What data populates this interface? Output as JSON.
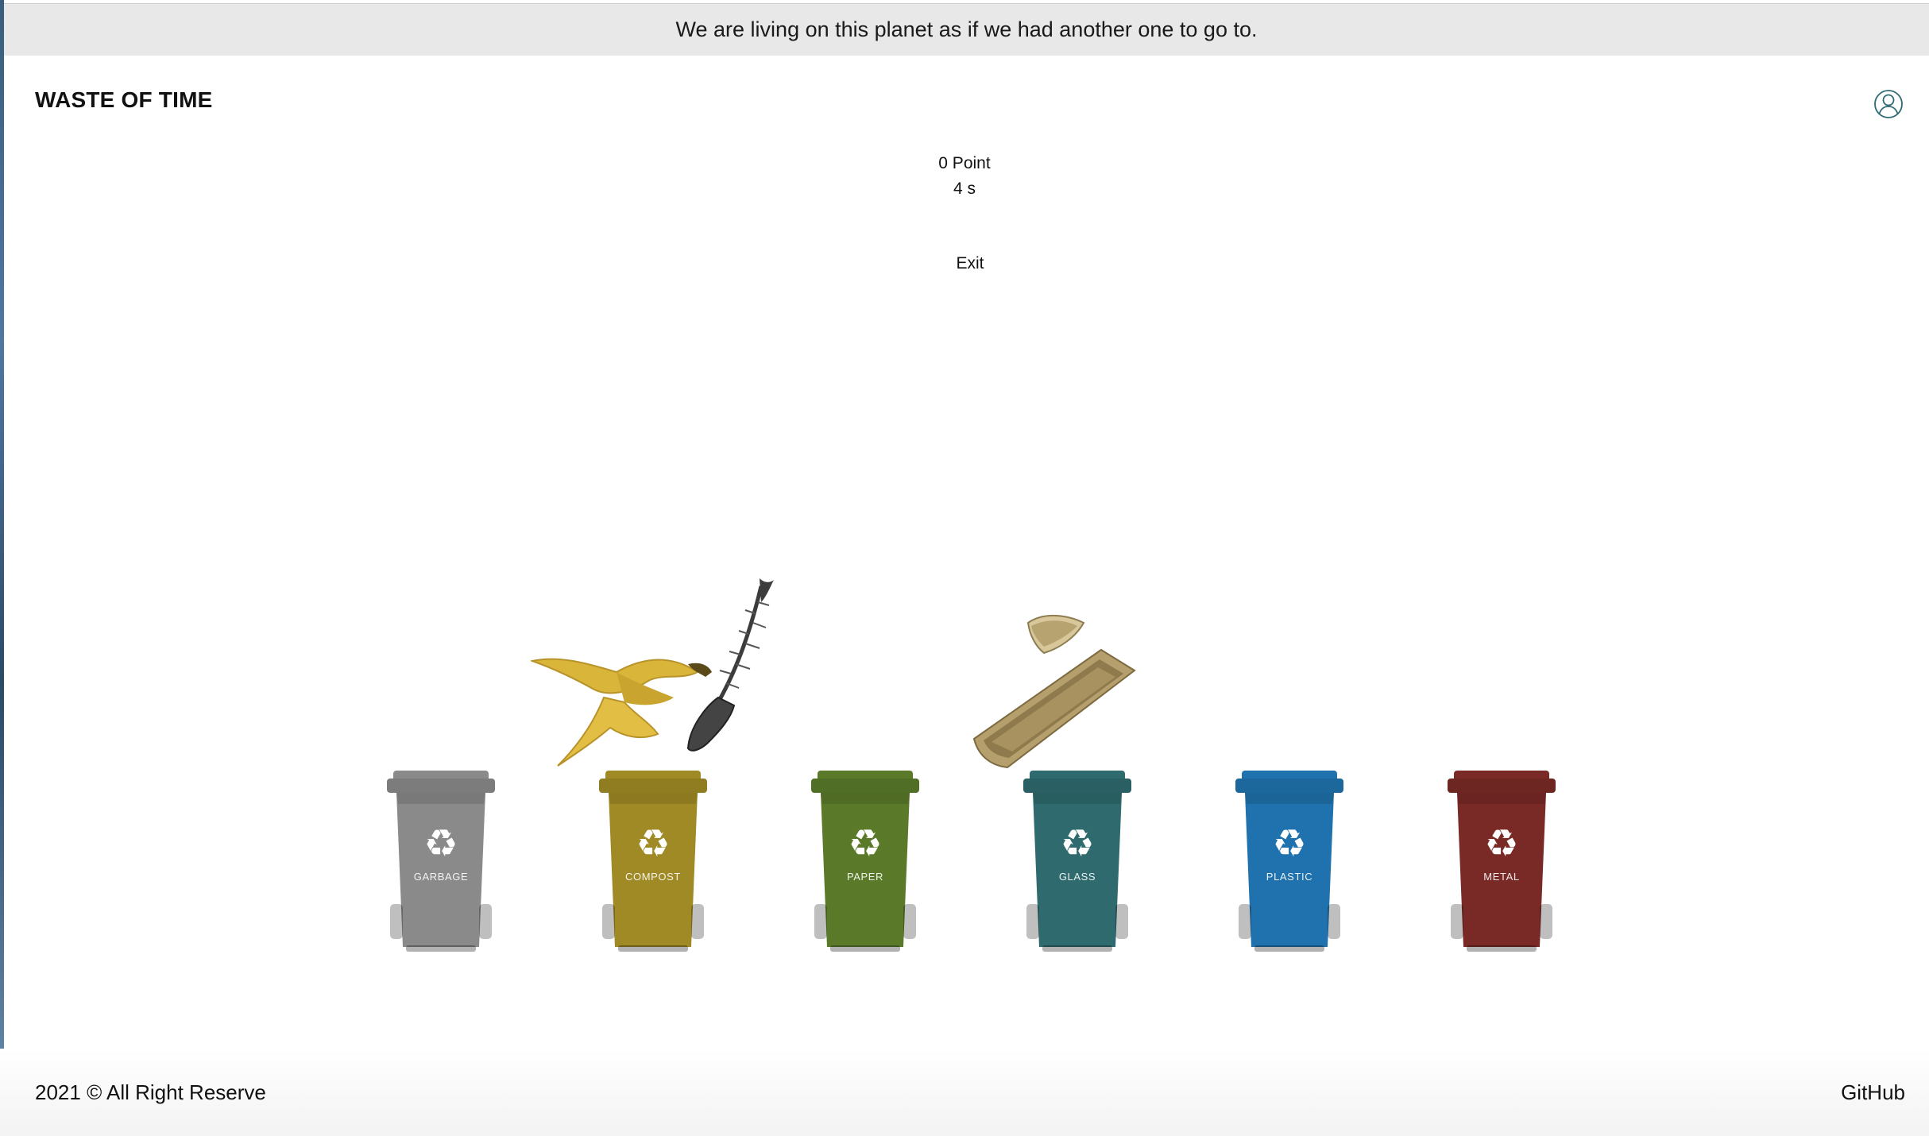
{
  "banner": {
    "quote": "We are living on this planet as if we had another one to go to."
  },
  "header": {
    "title": "WASTE OF TIME",
    "user_icon": "user-circle-icon"
  },
  "game": {
    "score_text": "0 Point",
    "timer_text": "4 s",
    "exit_label": "Exit",
    "falling_items": [
      "banana-peel-and-fish-bone",
      "open-sardine-can"
    ],
    "bins": [
      {
        "label": "GARBAGE",
        "color": "#8a8a8a"
      },
      {
        "label": "COMPOST",
        "color": "#a08a25"
      },
      {
        "label": "PAPER",
        "color": "#5a7a2a"
      },
      {
        "label": "GLASS",
        "color": "#2f6b6e"
      },
      {
        "label": "PLASTIC",
        "color": "#1f72ad"
      },
      {
        "label": "METAL",
        "color": "#7a2a26"
      }
    ]
  },
  "footer": {
    "copyright": "2021 © All Right Reserve",
    "link": "GitHub"
  }
}
